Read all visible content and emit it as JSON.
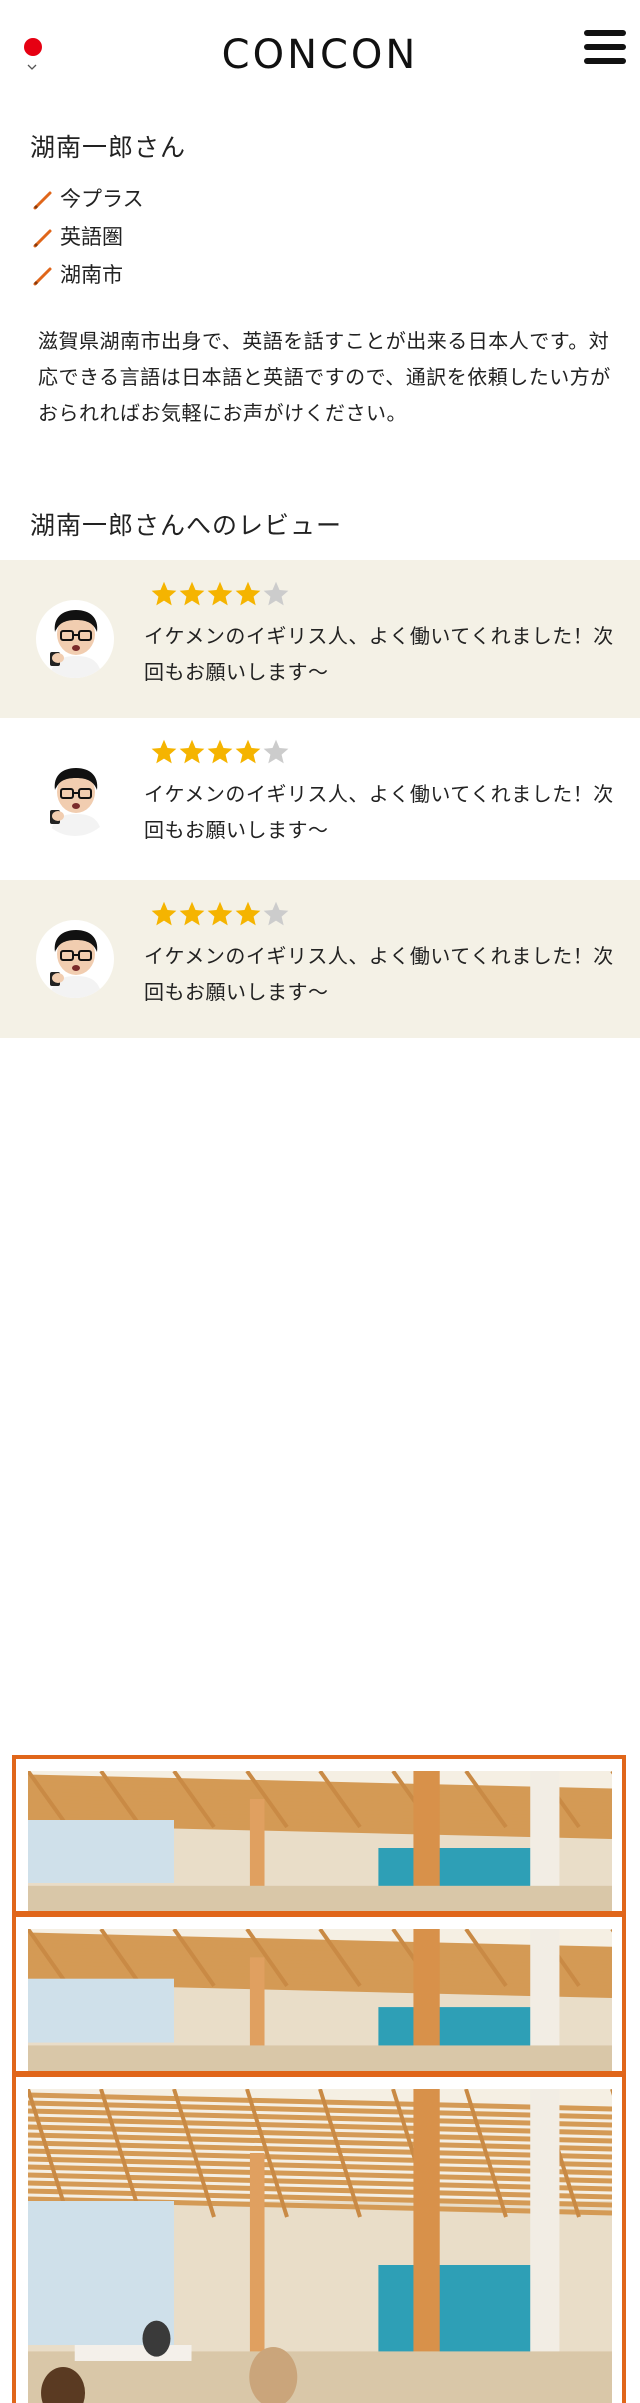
{
  "header": {
    "logo_text": "CONCON",
    "language_flag_icon": "red-circle-flag-icon",
    "language_chevron_icon": "chevron-down-icon",
    "menu_icon": "hamburger-menu-icon"
  },
  "profile": {
    "name": "湖南一郎さん",
    "tags": [
      {
        "icon": "pencil-icon",
        "label": "今プラス"
      },
      {
        "icon": "pencil-icon",
        "label": "英語圏"
      },
      {
        "icon": "pencil-icon",
        "label": "湖南市"
      }
    ],
    "bio": "滋賀県湖南市出身で、英語を話すことが出来る日本人です。対応できる言語は日本語と英語ですので、通訳を依頼したい方がおられればお気軽にお声がけください。"
  },
  "reviews": {
    "title": "湖南一郎さんへのレビュー",
    "items": [
      {
        "rating": 4,
        "max_rating": 5,
        "text": "イケメンのイギリス人、よく働いてくれました！次回もお願いします〜"
      },
      {
        "rating": 4,
        "max_rating": 5,
        "text": "イケメンのイギリス人、よく働いてくれました！次回もお願いします〜"
      },
      {
        "rating": 4,
        "max_rating": 5,
        "text": "イケメンのイギリス人、よく働いてくれました！次回もお願いします〜"
      }
    ]
  },
  "colors": {
    "accent_orange": "#e0661a",
    "flag_red": "#e60012",
    "review_shade": "#f4f1e6",
    "star_filled": "#f5b400",
    "star_empty": "#cccccc"
  }
}
